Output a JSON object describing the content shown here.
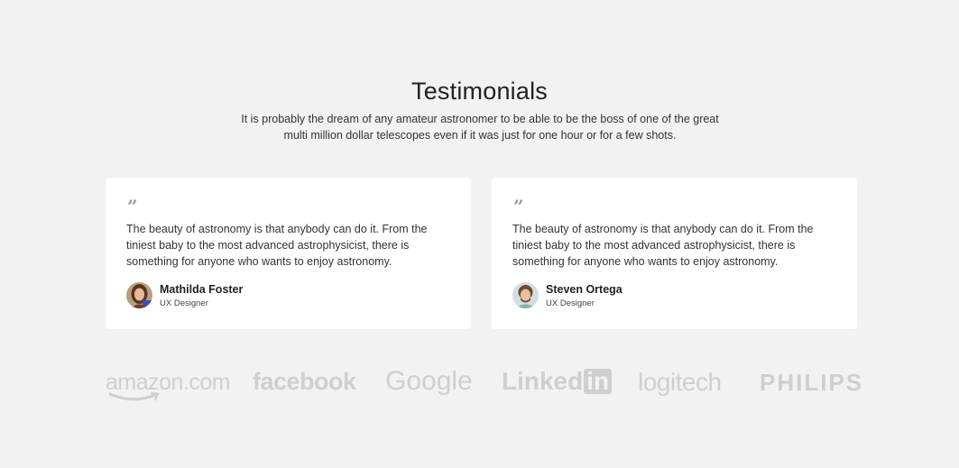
{
  "header": {
    "title": "Testimonials",
    "subtitle": "It is probably the dream of any amateur astronomer to be able to be the boss of one of the great multi million dollar telescopes even if it was just for one hour or for a few shots."
  },
  "testimonials": [
    {
      "quote_mark": "”",
      "text": "The beauty of astronomy is that anybody can do it. From the tiniest baby to the most advanced astrophysicist, there is something for anyone who wants to enjoy astronomy.",
      "name": "Mathilda Foster",
      "role": "UX Designer"
    },
    {
      "quote_mark": "”",
      "text": "The beauty of astronomy is that anybody can do it. From the tiniest baby to the most advanced astrophysicist, there is something for anyone who wants to enjoy astronomy.",
      "name": "Steven Ortega",
      "role": "UX Designer"
    }
  ],
  "logos": {
    "amazon": "amazon.com",
    "facebook": "facebook",
    "google": "Google",
    "linkedin_text": "Linked",
    "linkedin_box": "in",
    "logitech": "logitech",
    "philips": "PHILIPS"
  },
  "colors": {
    "background": "#f2f2f2",
    "card": "#ffffff",
    "logo_gray": "#cfcfcf"
  }
}
